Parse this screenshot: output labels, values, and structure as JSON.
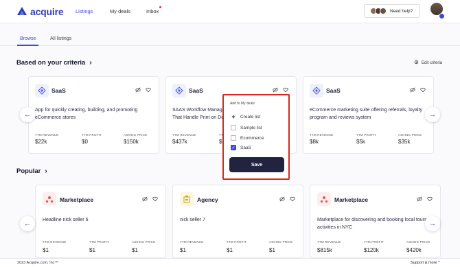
{
  "brand": {
    "name": "acquire"
  },
  "nav": {
    "listings": "Listings",
    "my_deals": "My deals",
    "inbox": "Inbox"
  },
  "help": {
    "label": "Need help?"
  },
  "tabs": [
    "Browse",
    "All listings"
  ],
  "criteria_section": {
    "title": "Based on your criteria",
    "edit_label": "Edit criteria"
  },
  "popular_section": {
    "title": "Popular"
  },
  "metric_labels": {
    "revenue": "TTM REVENUE",
    "profit": "TTM PROFIT",
    "price": "ASKING PRICE"
  },
  "criteria_cards": [
    {
      "category": "SaaS",
      "description": [
        "App for quickly creating, building, and promoting",
        "eCommerce stores"
      ],
      "revenue": "$22k",
      "profit": "$0",
      "price": "$150k"
    },
    {
      "category": "SaaS",
      "description": [
        "SAAS Workflow Manage",
        "That Handle Print on Der"
      ],
      "revenue": "$437k",
      "profit": "$9",
      "price": ""
    },
    {
      "category": "SaaS",
      "description": [
        "eCommerce marketing suite offering referrals, loyalty",
        "program and reviews system"
      ],
      "revenue": "$8k",
      "profit": "$5k",
      "price": "$35k"
    }
  ],
  "popular_cards": [
    {
      "category": "Marketplace",
      "description": [
        "Headline nick seller 6"
      ],
      "revenue": "$1",
      "profit": "$1",
      "price": "$1"
    },
    {
      "category": "Agency",
      "description": [
        "nick seller 7"
      ],
      "revenue": "$1",
      "profit": "$1",
      "price": "$1"
    },
    {
      "category": "Marketplace",
      "description": [
        "Marketplace for discovering and booking local tours &",
        "activities in NYC"
      ],
      "revenue": "$815k",
      "profit": "$120k",
      "price": "$420k"
    }
  ],
  "add_popup": {
    "title": "Add to My deals",
    "create_label": "Create list",
    "lists": [
      {
        "label": "Sample list",
        "checked": false
      },
      {
        "label": "Ecommerce",
        "checked": false
      },
      {
        "label": "SaaS",
        "checked": true
      }
    ],
    "save_label": "Save"
  },
  "footer": {
    "copyright": "2023 Acquire.com, Inc™",
    "support": "Support & more"
  },
  "colors": {
    "accent": "#3b49df",
    "save_button": "#22243f",
    "popup_border": "#d7261e",
    "saas_icon_bg": "#eef0fd",
    "marketplace_icon_bg": "#fdeeee",
    "agency_icon_bg": "#fdf6dc"
  },
  "icons": [
    "saas-icon",
    "marketplace-icon",
    "agency-icon",
    "hide-icon",
    "heart-icon",
    "gear-icon",
    "chevron-right-icon",
    "arrow-left-icon",
    "arrow-right-icon",
    "plus-icon",
    "check-icon",
    "chevron-up-icon"
  ]
}
